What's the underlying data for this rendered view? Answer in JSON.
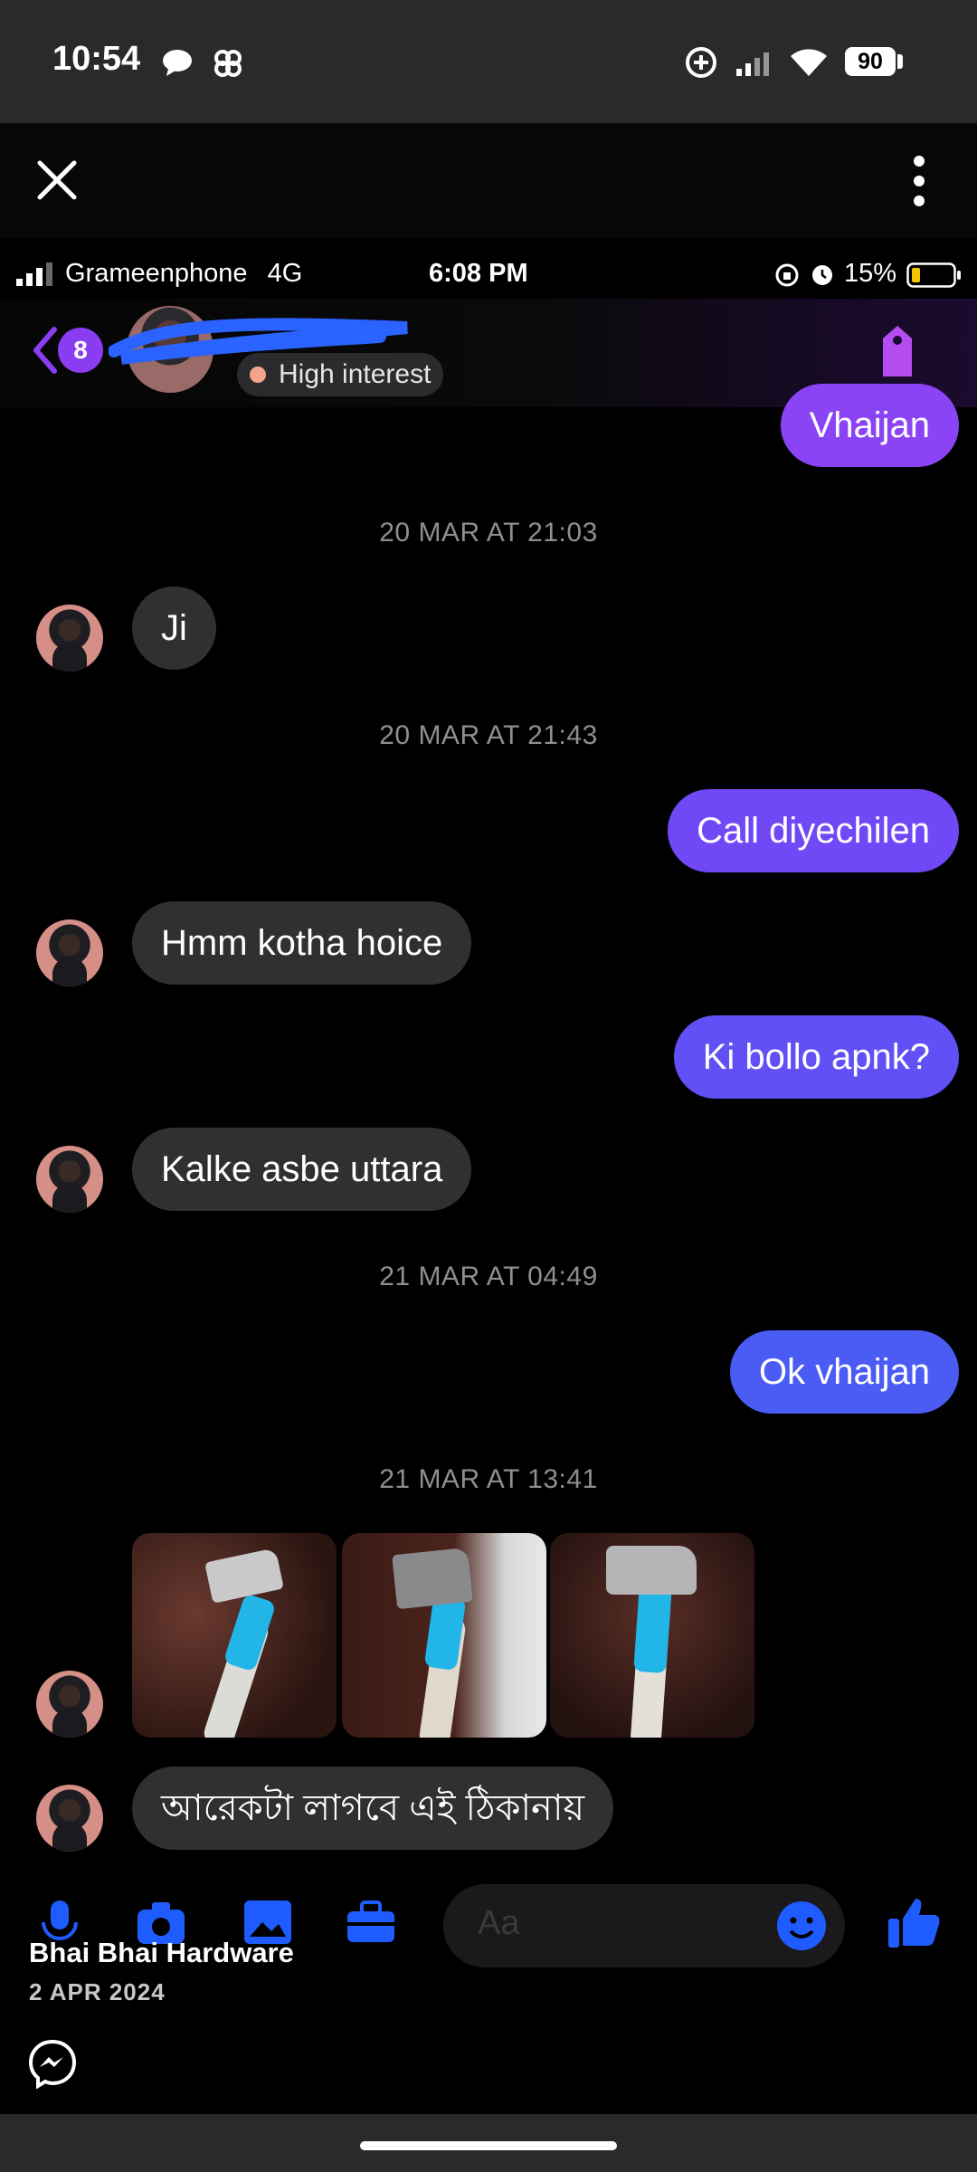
{
  "status_bar": {
    "time": "10:54",
    "battery": "90",
    "icons": [
      "chat-bubble-icon",
      "pinwheel-icon",
      "data-saver-icon",
      "signal-icon",
      "wifi-icon",
      "battery-icon"
    ]
  },
  "viewer": {
    "close_icon": "close-icon",
    "more_icon": "more-vertical-icon"
  },
  "inner_status": {
    "carrier": "Grameenphone",
    "network": "4G",
    "time": "6:08 PM",
    "battery": "15%"
  },
  "inner_header": {
    "back_count": "8",
    "interest_label": "High interest",
    "accent": "#8a3cf0"
  },
  "messages": [
    {
      "type": "out",
      "text": "Vhaijan"
    },
    {
      "type": "date",
      "text": "20 MAR AT 21:03"
    },
    {
      "type": "in",
      "text": "Ji"
    },
    {
      "type": "date",
      "text": "20 MAR AT 21:43"
    },
    {
      "type": "out",
      "text": "Call diyechilen"
    },
    {
      "type": "in",
      "text": "Hmm kotha hoice"
    },
    {
      "type": "out",
      "text": "Ki bollo apnk?"
    },
    {
      "type": "in",
      "text": "Kalke asbe uttara"
    },
    {
      "type": "date",
      "text": "21 MAR AT 04:49"
    },
    {
      "type": "out",
      "text": "Ok vhaijan"
    },
    {
      "type": "date",
      "text": "21 MAR AT 13:41"
    },
    {
      "type": "in",
      "text": "আরেকটা লাগবে এই ঠিকানায়"
    }
  ],
  "composer": {
    "placeholder": "Aa",
    "icons": [
      "microphone-icon",
      "camera-icon",
      "gallery-icon",
      "briefcase-icon",
      "emoji-icon",
      "thumbs-up-icon"
    ]
  },
  "overlay": {
    "page_name": "Bhai Bhai Hardware",
    "post_date": "2 APR 2024"
  },
  "colors": {
    "outgoing_purple": "#8a44f6",
    "outgoing_blue": "#4b5cf5",
    "incoming": "#303033",
    "composer_blue": "#1f5cff"
  }
}
